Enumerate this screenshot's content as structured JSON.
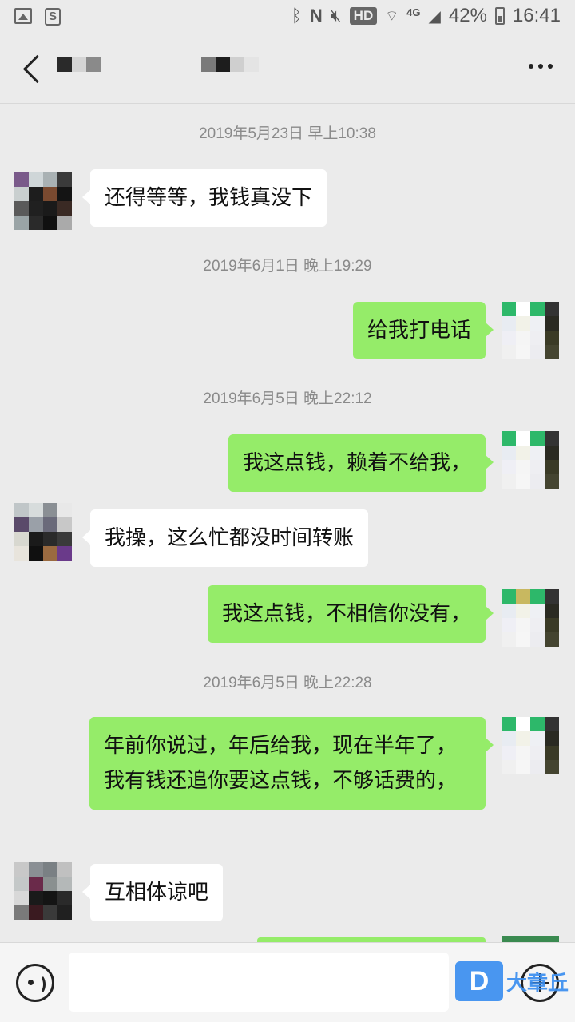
{
  "status_bar": {
    "battery": "42%",
    "time": "16:41",
    "network": "4G",
    "hd": "HD",
    "icons": [
      "image-icon",
      "s-app-icon",
      "bluetooth-icon",
      "nfc-icon",
      "mute-icon",
      "wifi-icon",
      "signal-icon",
      "battery-icon"
    ]
  },
  "header": {
    "back_icon": "back-arrow-icon",
    "more_icon": "more-dots-icon"
  },
  "messages": [
    {
      "kind": "time",
      "text": "2019年5月23日 早上10:38"
    },
    {
      "kind": "recv",
      "text": "还得等等，我钱真没下"
    },
    {
      "kind": "time",
      "text": "2019年6月1日 晚上19:29"
    },
    {
      "kind": "sent",
      "text": "给我打电话"
    },
    {
      "kind": "time",
      "text": "2019年6月5日 晚上22:12"
    },
    {
      "kind": "sent",
      "text": "我这点钱，赖着不给我，"
    },
    {
      "kind": "recv",
      "text": "我操，这么忙都没时间转账"
    },
    {
      "kind": "sent",
      "text": "我这点钱，不相信你没有，"
    },
    {
      "kind": "time",
      "text": "2019年6月5日 晚上22:28"
    },
    {
      "kind": "sent",
      "text": "年前你说过，年后给我，现在半年了，我有钱还追你要这点钱，不够话费的，"
    },
    {
      "kind": "recv",
      "text": "互相体谅吧"
    }
  ],
  "input_bar": {
    "voice_icon": "voice-input-icon",
    "plus_icon": "plus-icon",
    "placeholder": ""
  },
  "watermark": {
    "logo": "D",
    "text": "大章丘"
  },
  "colors": {
    "background": "#ebebeb",
    "sent_bubble": "#95ec69",
    "recv_bubble": "#ffffff",
    "watermark": "#3b8ff0"
  }
}
